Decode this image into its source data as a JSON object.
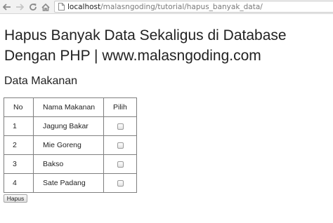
{
  "browser": {
    "url_host": "localhost",
    "url_path": "/malasngoding/tutorial/hapus_banyak_data/"
  },
  "page": {
    "title": "Hapus Banyak Data Sekaligus di Database Dengan PHP | www.malasngoding.com",
    "section_title": "Data Makanan"
  },
  "table": {
    "headers": [
      "No",
      "Nama Makanan",
      "Pilih"
    ],
    "rows": [
      {
        "no": "1",
        "name": "Jagung Bakar",
        "checked": false
      },
      {
        "no": "2",
        "name": "Mie Goreng",
        "checked": false
      },
      {
        "no": "3",
        "name": "Bakso",
        "checked": false
      },
      {
        "no": "4",
        "name": "Sate Padang",
        "checked": false
      }
    ]
  },
  "form": {
    "submit_label": "Hapus"
  },
  "icons": [
    "back-arrow-icon",
    "forward-arrow-icon",
    "reload-icon",
    "home-icon",
    "page-icon",
    "checkbox"
  ]
}
